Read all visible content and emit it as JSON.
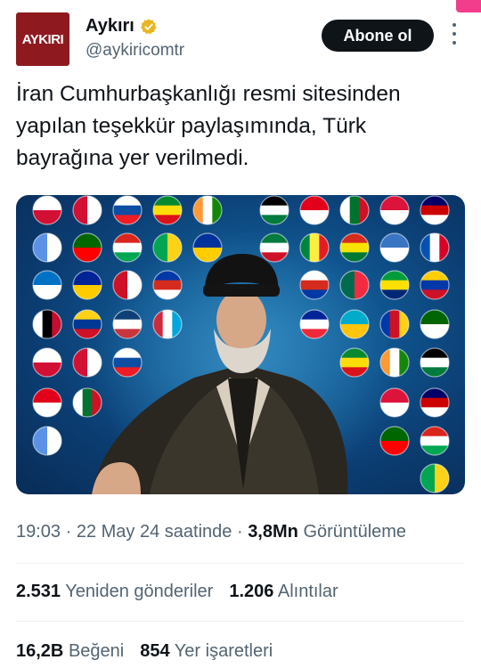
{
  "account": {
    "display_name": "Aykırı",
    "handle": "@aykiricomtr",
    "avatar_text": "AYKIRI",
    "verified_icon": "verified-badge-icon",
    "verified_color": "#e8b623"
  },
  "actions": {
    "follow_label": "Abone ol",
    "more_icon": "more-icon"
  },
  "tweet": {
    "text": "İran Cumhurbaşkanlığı resmi sitesinden yapılan teşekkür paylaşımında, Türk bayrağına yer verilmedi."
  },
  "media": {
    "description_icon": "flags-collage-image"
  },
  "meta": {
    "time": "19:03",
    "sep1": " · ",
    "date_text": "22 May 24 saatinde",
    "sep2": " · ",
    "views_value": "3,8Mn",
    "views_label": "Görüntüleme"
  },
  "stats": {
    "reposts_value": "2.531",
    "reposts_label": "Yeniden gönderiler",
    "quotes_value": "1.206",
    "quotes_label": "Alıntılar",
    "likes_value": "16,2B",
    "likes_label": "Beğeni",
    "bookmarks_value": "854",
    "bookmarks_label": "Yer işaretleri"
  },
  "colors": {
    "text_primary": "#0f1419",
    "text_secondary": "#536471",
    "follow_bg": "#0f1419",
    "avatar_bg": "#8e1a1f"
  }
}
